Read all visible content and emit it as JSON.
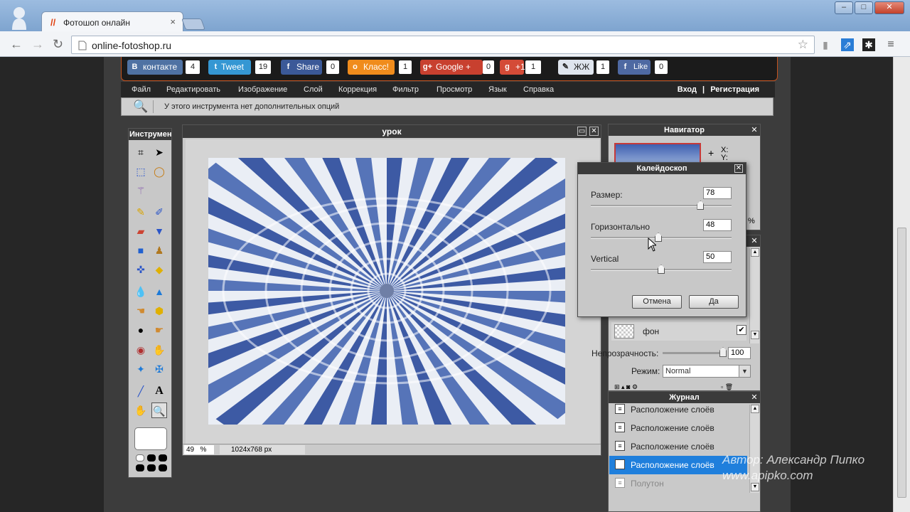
{
  "browser": {
    "tab_title": "Фотошоп онлайн",
    "tab_favicon": "//",
    "url": "online-fotoshop.ru"
  },
  "social": {
    "buttons": [
      {
        "label": "контакте",
        "count": "4",
        "color": "#4f72a3",
        "icon": "В"
      },
      {
        "label": "Tweet",
        "count": "19",
        "color": "#3597d3",
        "icon": "t"
      },
      {
        "label": "Share",
        "count": "0",
        "color": "#3b5998",
        "icon": "f"
      },
      {
        "label": "Класс!",
        "count": "1",
        "color": "#f08c1c",
        "icon": "о"
      },
      {
        "label": "Google +",
        "count": "0",
        "color": "#c8402f",
        "icon": "g+"
      },
      {
        "label": "+1",
        "count": "1",
        "color": "#d44b37",
        "icon": "g"
      },
      {
        "label": "ЖЖ",
        "count": "1",
        "color": "#dfe5ee",
        "icon": "✎"
      },
      {
        "label": "Like",
        "count": "0",
        "color": "#4e69a2",
        "icon": "f"
      }
    ]
  },
  "menu": {
    "items": [
      "Файл",
      "Редактировать",
      "Изображение",
      "Слой",
      "Коррекция",
      "Фильтр",
      "Просмотр",
      "Язык",
      "Справка"
    ],
    "login": "Вход",
    "separator": "|",
    "register": "Регистрация"
  },
  "options_bar": {
    "text": "У этого инструмента нет дополнительных опций"
  },
  "tools": {
    "title": "Инструменты"
  },
  "document": {
    "title": "урок",
    "zoom": "49",
    "zoom_unit": "%",
    "size": "1024x768 px"
  },
  "navigator": {
    "title": "Навигатор",
    "x_label": "X:",
    "y_label": "Y:",
    "percent": "%"
  },
  "layers": {
    "layer_name": "фон",
    "opacity_label": "Непрозрачность:",
    "opacity_value": "100",
    "mode_label": "Режим:",
    "mode_value": "Normal"
  },
  "journal": {
    "title": "Журнал",
    "items": [
      "Расположение слоёв",
      "Расположение слоёв",
      "Расположение слоёв",
      "Расположение слоёв",
      "Полутон"
    ]
  },
  "dialog": {
    "title": "Калейдоскоп",
    "params": [
      {
        "label": "Размер:",
        "value": "78",
        "fraction": 0.78
      },
      {
        "label": "Горизонтально",
        "value": "48",
        "fraction": 0.48
      },
      {
        "label": "Vertical",
        "value": "50",
        "fraction": 0.5
      }
    ],
    "cancel": "Отмена",
    "ok": "Да"
  },
  "watermark": {
    "line1": "Автор: Александр Пипко",
    "line2": "www.apipko.com"
  }
}
